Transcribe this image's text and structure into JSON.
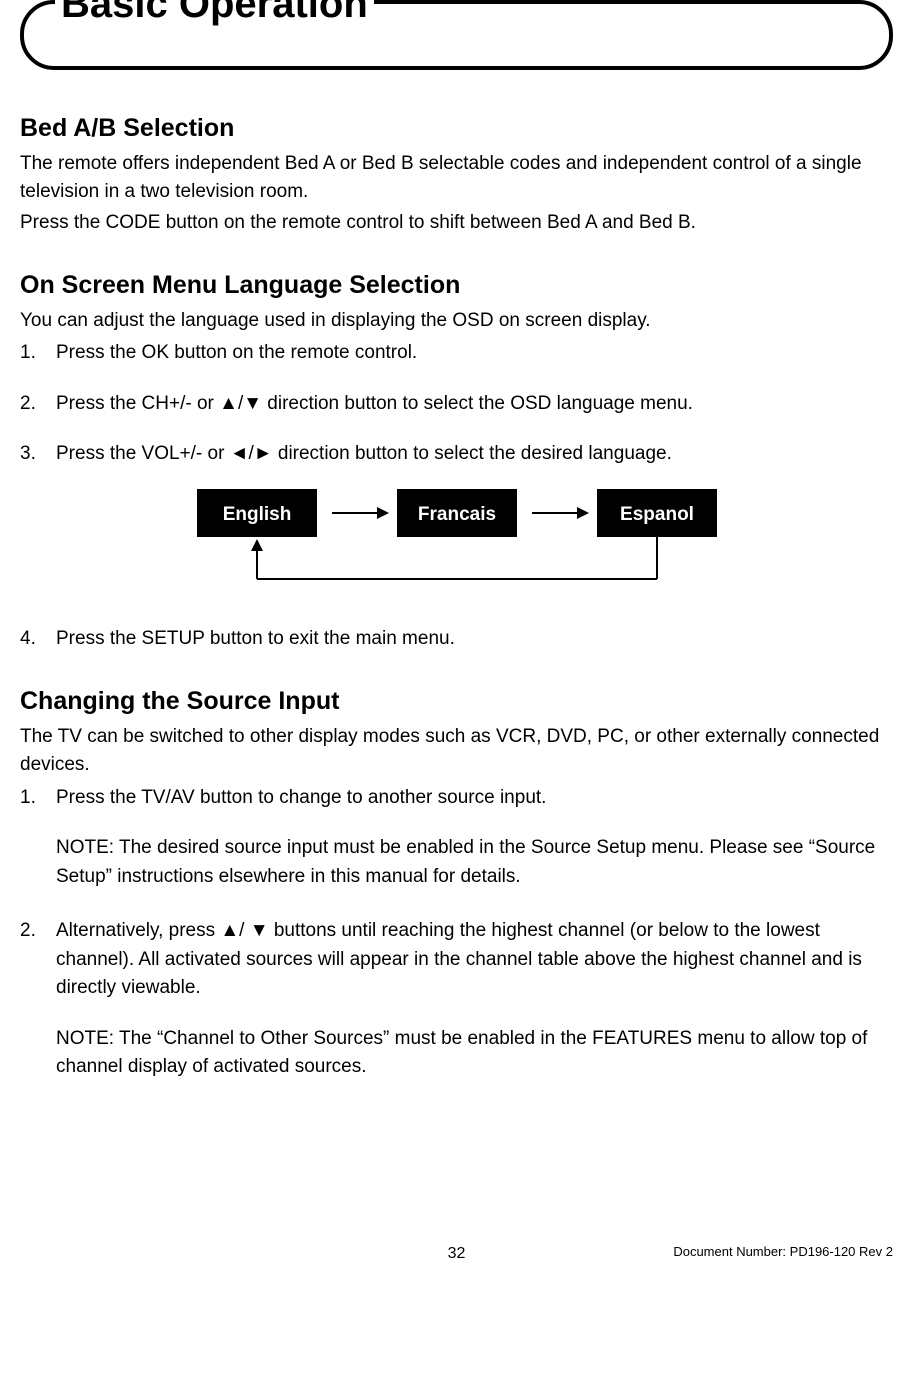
{
  "title": "Basic Operation",
  "sections": {
    "bed": {
      "heading": "Bed A/B Selection",
      "p1": "The remote offers independent Bed A or Bed B selectable codes and independent control of a single television in a two television room.",
      "p2": "Press the CODE button on the remote control to shift between Bed A and Bed B."
    },
    "lang": {
      "heading": "On Screen Menu Language Selection",
      "p1": "You can adjust the language used in displaying the OSD on screen display.",
      "items": {
        "n1": "1.",
        "t1": "Press the OK button on the remote control.",
        "n2": "2.",
        "t2": "Press the CH+/- or ▲/▼ direction button to select the OSD language menu.",
        "n3": "3.",
        "t3": "Press the VOL+/- or ◄/► direction button to select the desired language.",
        "n4": "4.",
        "t4": "Press the SETUP button to exit the main menu."
      },
      "diagram": {
        "opt1": "English",
        "opt2": "Francais",
        "opt3": "Espanol"
      }
    },
    "source": {
      "heading": "Changing the Source Input",
      "p1": "The TV can be switched to other display modes such as VCR, DVD, PC, or other externally connected devices.",
      "items": {
        "n1": "1.",
        "t1": "Press the TV/AV button to change to another source input.",
        "note1": "NOTE: The desired source input must be enabled in the Source Setup menu. Please see “Source Setup” instructions elsewhere in this manual for details.",
        "n2": "2.",
        "t2": "Alternatively, press ▲/ ▼ buttons until reaching the highest channel (or below to the lowest channel). All activated sources will appear in the channel table above the highest channel and is directly viewable.",
        "note2": "NOTE: The “Channel to Other Sources” must be enabled in the FEATURES menu to allow top of channel display of activated sources."
      }
    }
  },
  "footer": {
    "page": "32",
    "doc": "Document Number: PD196-120 Rev 2"
  }
}
